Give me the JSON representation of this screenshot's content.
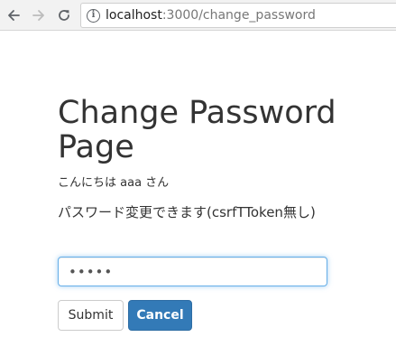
{
  "browser": {
    "url_host": "localhost",
    "url_path": ":3000/change_password"
  },
  "page": {
    "title": "Change Password Page",
    "greeting": "こんにちは aaa さん",
    "description": "パスワード変更できます(csrfTToken無し)"
  },
  "form": {
    "password_value": "aaaaa",
    "submit_label": "Submit",
    "cancel_label": "Cancel"
  },
  "colors": {
    "primary": "#337ab7",
    "focus_border": "#66afe9",
    "text": "#333333"
  },
  "icons": [
    "back-arrow-icon",
    "forward-arrow-icon",
    "reload-icon",
    "info-icon"
  ]
}
